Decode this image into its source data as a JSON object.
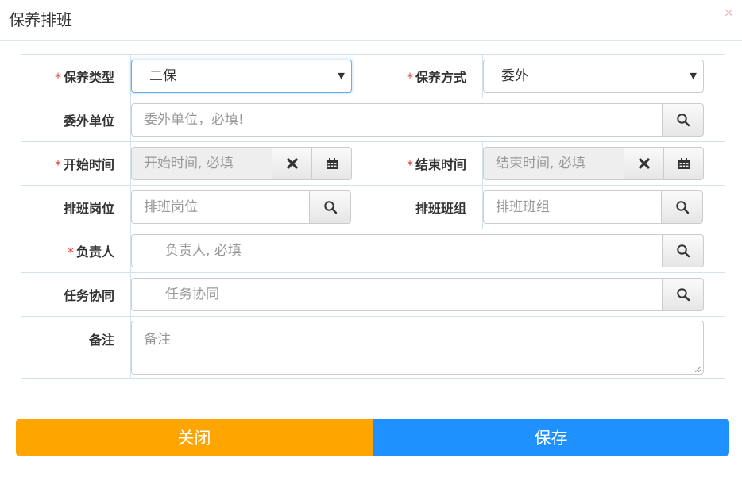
{
  "dialog": {
    "title": "保养排班",
    "close_glyph": "×"
  },
  "required_mark": "*",
  "fields": {
    "maint_type": {
      "label": "保养类型",
      "value": "二保",
      "required": true
    },
    "maint_method": {
      "label": "保养方式",
      "value": "委外",
      "required": true
    },
    "outsource_unit": {
      "label": "委外单位",
      "placeholder": "委外单位，必填!",
      "required": false
    },
    "start_time": {
      "label": "开始时间",
      "placeholder": "开始时间, 必填",
      "required": true
    },
    "end_time": {
      "label": "结束时间",
      "placeholder": "结束时间, 必填",
      "required": true
    },
    "shift_post": {
      "label": "排班岗位",
      "placeholder": "排班岗位",
      "required": false
    },
    "shift_group": {
      "label": "排班班组",
      "placeholder": "排班班组",
      "required": false
    },
    "person_in_charge": {
      "label": "负责人",
      "placeholder": "负责人, 必填",
      "required": true
    },
    "task_collab": {
      "label": "任务协同",
      "placeholder": "任务协同",
      "required": false
    },
    "remark": {
      "label": "备注",
      "placeholder": "备注",
      "required": false
    }
  },
  "icons": {
    "search": "search-icon",
    "clear": "times-icon",
    "calendar": "calendar-icon",
    "dropdown": "caret-down-icon"
  },
  "footer": {
    "close_label": "关闭",
    "save_label": "保存"
  },
  "colors": {
    "close_button": "#ffa500",
    "save_button": "#1e90ff",
    "required": "#e4393c",
    "close_x": "#f0b9b9"
  }
}
